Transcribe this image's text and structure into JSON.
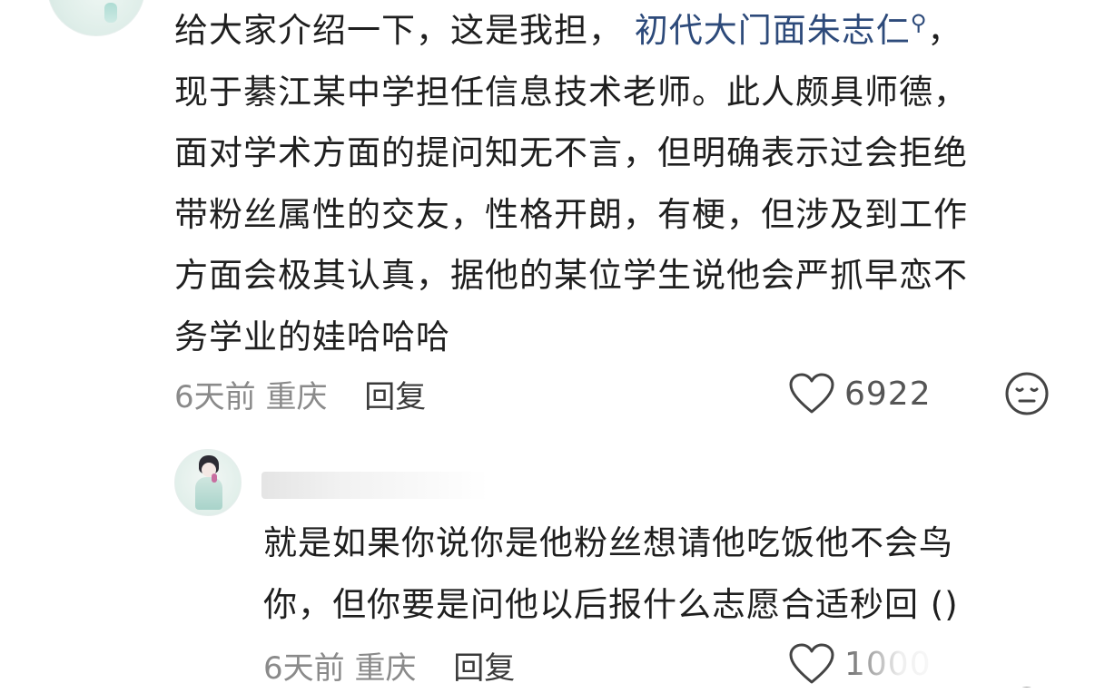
{
  "comment": {
    "lines": [
      "给大家介绍一下，这是我担，",
      "现于綦江某中学担任信息技术老师。此人颇具师德，",
      "面对学术方面的提问知无不言，但明确表示过会拒绝",
      "带粉丝属性的交友，性格开朗，有梗，但涉及到工作",
      "方面会极其认真，据他的某位学生说他会严抓早恋不",
      "务学业的娃哈哈哈"
    ],
    "mention": "初代大门面朱志仁",
    "after_mention": "，",
    "time": "6天前",
    "location": "重庆",
    "reply_label": "回复",
    "like_count": "6922"
  },
  "reply": {
    "lines": [
      "就是如果你说你是他粉丝想请他吃饭他不会鸟",
      "你，但你要是问他以后报什么志愿合适秒回 ()"
    ],
    "time": "6天前",
    "location": "重庆",
    "reply_label": "回复",
    "like_count": "1000"
  },
  "icons": {
    "like": "heart-outline-icon",
    "reaction": "neutral-face-icon",
    "mention": "search-icon"
  },
  "colors": {
    "text": "#1f1f1f",
    "mention": "#2d4a7a",
    "meta": "#8a8a8a"
  }
}
